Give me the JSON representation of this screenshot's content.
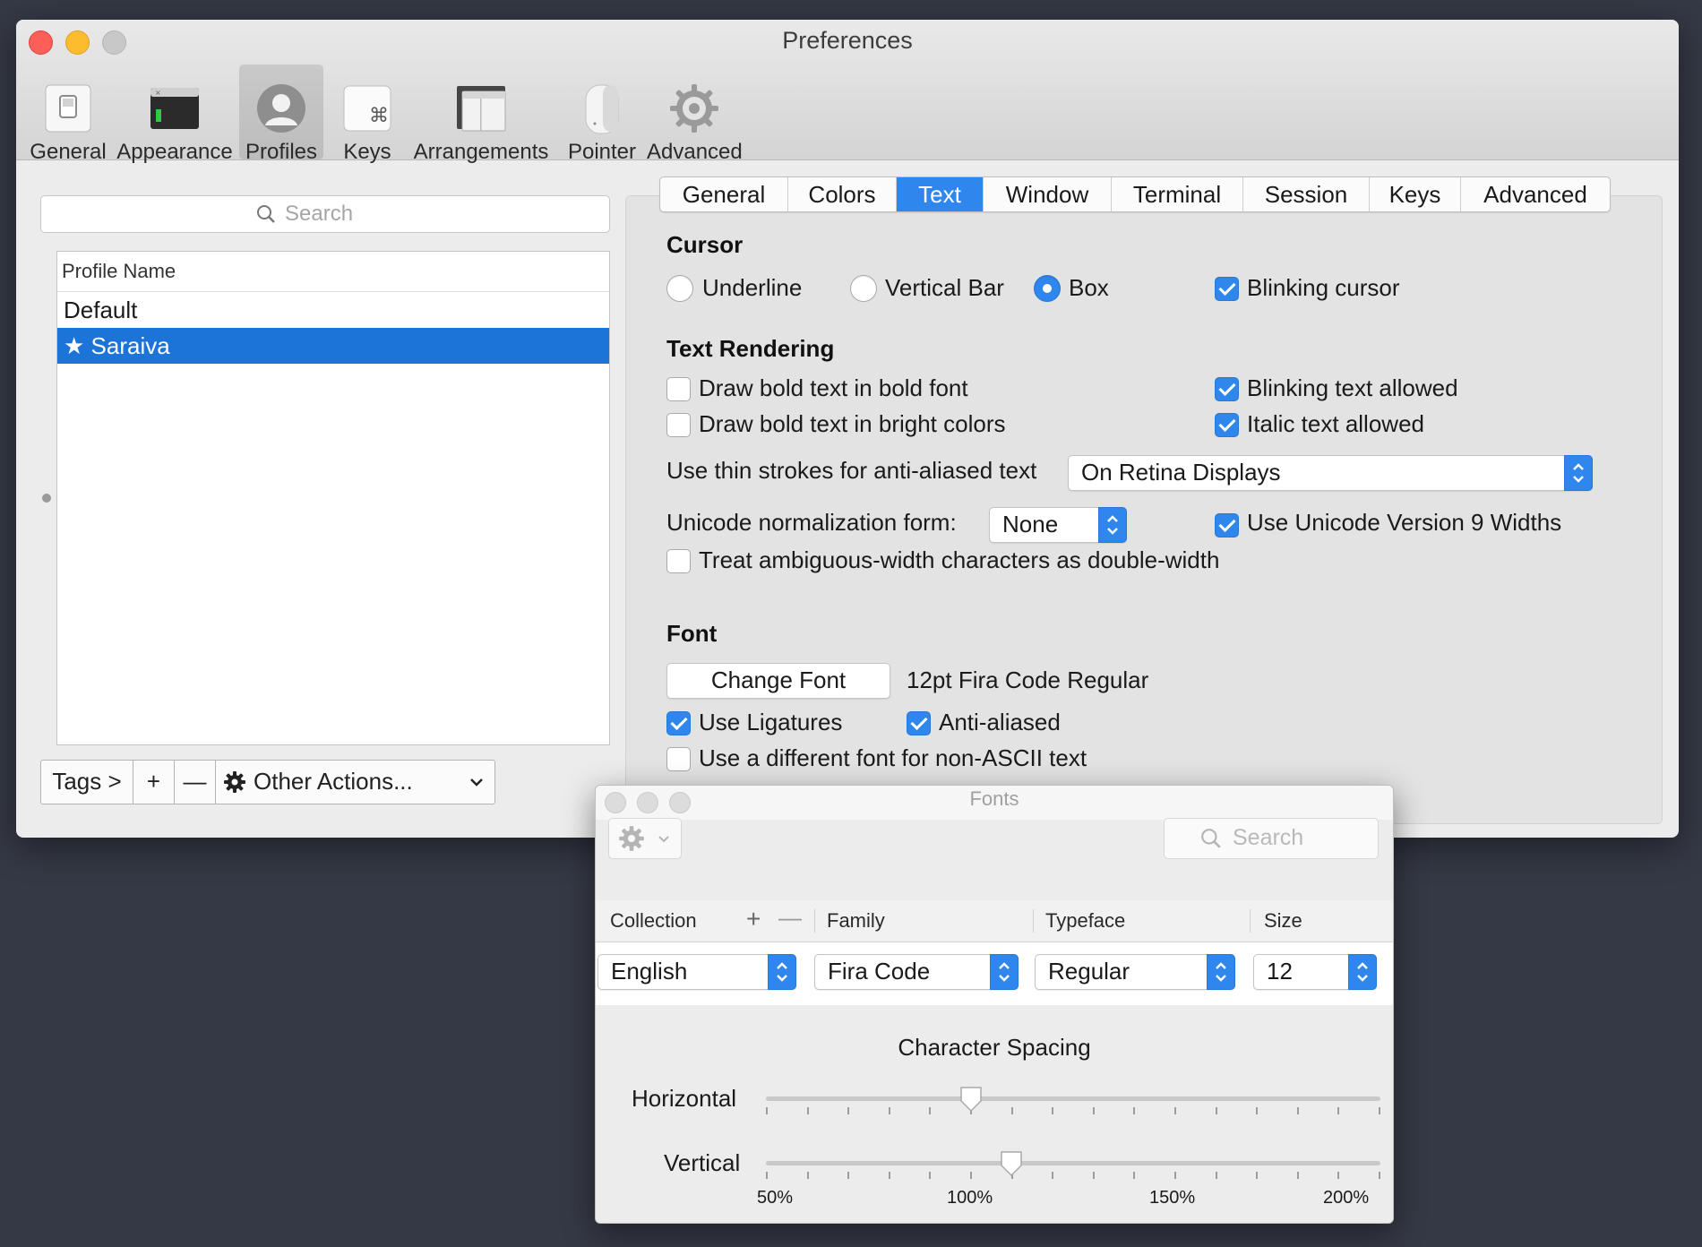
{
  "window": {
    "title": "Preferences"
  },
  "toolbar": {
    "items": [
      {
        "label": "General",
        "icon": "switch-icon"
      },
      {
        "label": "Appearance",
        "icon": "terminal-window-icon"
      },
      {
        "label": "Profiles",
        "icon": "person-icon"
      },
      {
        "label": "Keys",
        "icon": "command-key-icon"
      },
      {
        "label": "Arrangements",
        "icon": "windows-icon"
      },
      {
        "label": "Pointer",
        "icon": "mouse-icon"
      },
      {
        "label": "Advanced",
        "icon": "gear-icon"
      }
    ],
    "selected": "Profiles"
  },
  "profiles": {
    "search_placeholder": "Search",
    "column_header": "Profile Name",
    "rows": [
      "Default",
      "★ Saraiva"
    ],
    "selected_index": 1,
    "bottom": {
      "tags": "Tags >",
      "add": "+",
      "remove": "—",
      "other_actions": "Other Actions..."
    }
  },
  "tabs": [
    "General",
    "Colors",
    "Text",
    "Window",
    "Terminal",
    "Session",
    "Keys",
    "Advanced"
  ],
  "selected_tab": "Text",
  "cursor": {
    "heading": "Cursor",
    "underline": "Underline",
    "vertical_bar": "Vertical Bar",
    "box": "Box",
    "selected": "Box",
    "blinking_label": "Blinking cursor",
    "blinking_checked": true
  },
  "text_rendering": {
    "heading": "Text Rendering",
    "bold_font": {
      "label": "Draw bold text in bold font",
      "checked": false
    },
    "bold_bright": {
      "label": "Draw bold text in bright colors",
      "checked": false
    },
    "blinking_text": {
      "label": "Blinking text allowed",
      "checked": true
    },
    "italic_text": {
      "label": "Italic text allowed",
      "checked": true
    },
    "thin_strokes_label": "Use thin strokes for anti-aliased text",
    "thin_strokes_value": "On Retina Displays",
    "unicode_norm_label": "Unicode normalization form:",
    "unicode_norm_value": "None",
    "unicode9": {
      "label": "Use Unicode Version 9 Widths",
      "checked": true
    },
    "ambiguous": {
      "label": "Treat ambiguous-width characters as double-width",
      "checked": false
    }
  },
  "font": {
    "heading": "Font",
    "change_button": "Change Font",
    "current": "12pt Fira Code Regular",
    "ligatures": {
      "label": "Use Ligatures",
      "checked": true
    },
    "anti_aliased": {
      "label": "Anti-aliased",
      "checked": true
    },
    "non_ascii": {
      "label": "Use a different font for non-ASCII text",
      "checked": false
    }
  },
  "fonts_panel": {
    "title": "Fonts",
    "search_placeholder": "Search",
    "columns": {
      "collection": "Collection",
      "family": "Family",
      "typeface": "Typeface",
      "size": "Size",
      "add": "+",
      "remove": "—"
    },
    "values": {
      "collection": "English",
      "family": "Fira Code",
      "typeface": "Regular",
      "size": "12"
    },
    "spacing_title": "Character Spacing",
    "horizontal_label": "Horizontal",
    "vertical_label": "Vertical",
    "horizontal_value_percent": 100,
    "vertical_value_percent": 110,
    "scale": [
      "50%",
      "100%",
      "150%",
      "200%"
    ]
  },
  "colors": {
    "accent": "#2f86ec",
    "selection": "#1d74d8"
  }
}
